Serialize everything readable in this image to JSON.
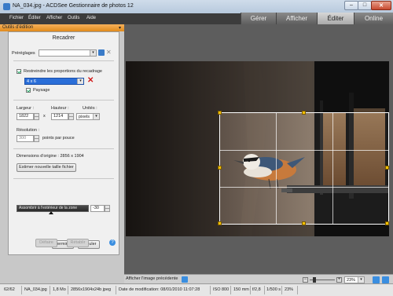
{
  "window": {
    "title": "NA_034.jpg - ACDSee Gestionnaire de photos 12"
  },
  "menu": [
    "Fichier",
    "Éditer",
    "Afficher",
    "Outils",
    "Aide"
  ],
  "modes": [
    "Gérer",
    "Afficher",
    "Éditer",
    "Online"
  ],
  "active_mode": "Éditer",
  "panel": {
    "title": "Outils d'édition",
    "dialog_title": "Recadrer",
    "presets_label": "Préréglages",
    "keep_ratio_label": "Restreindre les proportions du recadrage",
    "ratio_value": "4 x 6",
    "landscape_label": "Paysage",
    "width_label": "Largeur :",
    "height_label": "Hauteur :",
    "units_label": "Unités :",
    "width_value": "1822",
    "height_value": "1214",
    "times": "x",
    "units_value": "pixels",
    "resolution_label": "Résolution :",
    "resolution_value": "300",
    "resolution_unit": "points par pouce",
    "orig_dims": "Dimensions d'origine : 2856 x 1904",
    "estimate_button": "Estimer nouvelle taille fichier",
    "darken_label": "Assombrir à l'extérieur de la zone",
    "darken_value": "-30",
    "done_button": "Terminé",
    "cancel_button": "Annuler",
    "undo_button": "Défaire",
    "redo_button": "Rétablir"
  },
  "canvas": {
    "prev_label": "Afficher l'image précédente",
    "zoom_value": "23%"
  },
  "status": {
    "index": "62/62",
    "filename": "NA_034.jpg",
    "size": "1,8 Mo",
    "dims": "2856x1904x24b jpeg",
    "modified": "Date de modification: 08/01/2010 11:07:28",
    "iso": "ISO 800",
    "focal": "150 mm",
    "aperture": "f/2,8",
    "shutter": "1/500 s",
    "zoom": "23%"
  }
}
